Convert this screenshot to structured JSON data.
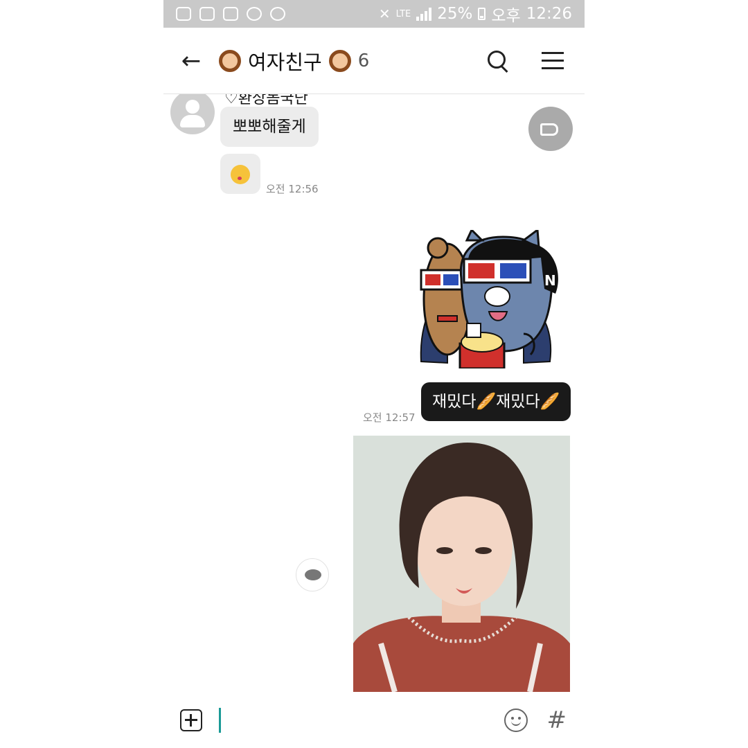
{
  "status_bar": {
    "network": "LTE",
    "battery": "25%",
    "ampm": "오후",
    "time": "12:26"
  },
  "header": {
    "title": "여자친구",
    "member_count": "6"
  },
  "messages": {
    "sender_name": "♡환상돔국단",
    "incoming_text": "뽀뽀해줄게",
    "incoming_time": "오전 12:56",
    "outgoing_text": "재밌다🥖재밌다🥖",
    "outgoing_time": "오전 12:57"
  },
  "icons": {
    "back": "back-arrow-icon",
    "search": "search-icon",
    "menu": "hamburger-menu-icon",
    "announce": "megaphone-icon",
    "comment": "comment-bubble-icon",
    "plus": "plus-box-icon",
    "emoji": "smile-icon",
    "hash": "hash-icon"
  },
  "colors": {
    "status_bar": "#c9c9c9",
    "incoming_bubble": "#ececec",
    "outgoing_bubble": "#1a1a1a",
    "cursor": "#1a9a96"
  }
}
